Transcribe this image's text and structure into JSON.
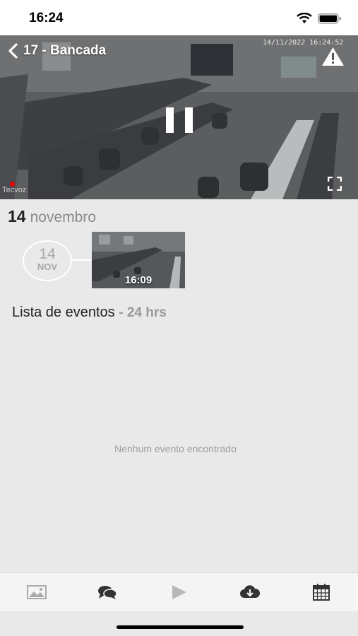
{
  "status_bar": {
    "time": "16:24"
  },
  "player": {
    "camera_title": "17 - Bancada",
    "timestamp": "14/11/2022 16:24:52",
    "watermark": "Tecvoz"
  },
  "recordings": {
    "day": "14",
    "month": "novembro",
    "circle_day": "14",
    "circle_month": "NOV",
    "clip_time": "16:09"
  },
  "events": {
    "title": "Lista de eventos",
    "range": "- 24 hrs",
    "empty_message": "Nenhum evento encontrado"
  },
  "tabbar": {
    "items": [
      "image-icon",
      "chat-icon",
      "play-icon",
      "cloud-download-icon",
      "calendar-icon"
    ]
  },
  "colors": {
    "accent": "#ffffff",
    "record": "#e00000"
  }
}
